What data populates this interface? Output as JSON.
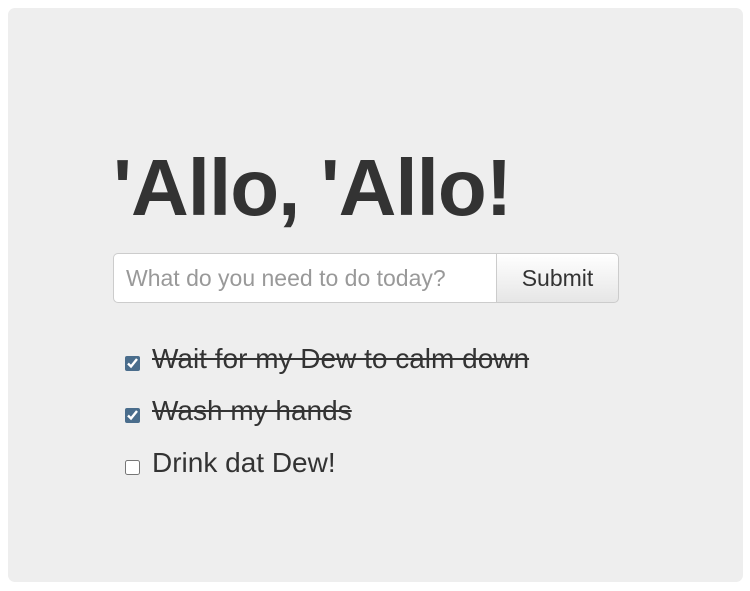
{
  "app": {
    "title": "'Allo, 'Allo!"
  },
  "form": {
    "input_value": "",
    "input_placeholder": "What do you need to do today?",
    "submit_label": "Submit"
  },
  "todos": [
    {
      "text": "Wait for my Dew to calm down",
      "done": true
    },
    {
      "text": "Wash my hands",
      "done": true
    },
    {
      "text": "Drink dat Dew!",
      "done": false
    }
  ],
  "colors": {
    "background": "#eeeeee",
    "text": "#333333",
    "placeholder": "#999999"
  }
}
